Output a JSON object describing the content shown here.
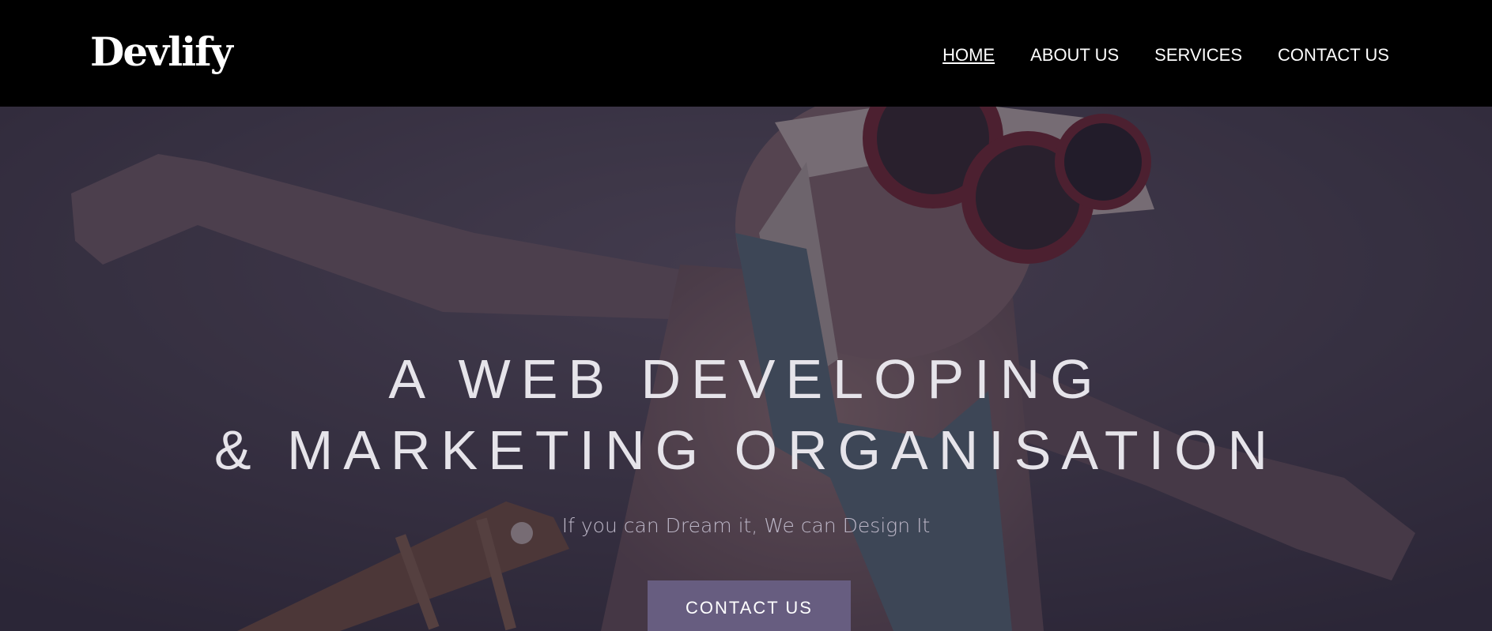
{
  "brand": {
    "logo_text": "Devlify"
  },
  "nav": {
    "items": [
      {
        "label": "HOME",
        "active": true
      },
      {
        "label": "ABOUT US",
        "active": false
      },
      {
        "label": "SERVICES",
        "active": false
      },
      {
        "label": "CONTACT US",
        "active": false
      }
    ]
  },
  "hero": {
    "headline_line1": "A WEB DEVELOPING",
    "headline_line2": "& MARKETING ORGANISATION",
    "tagline": "If you can Dream it, We can Design It",
    "cta_label": "CONTACT US",
    "background_image": "child wearing aviator goggles with arms outstretched"
  },
  "colors": {
    "navbar_bg": "#000000",
    "overlay": "#3a3148",
    "cta_bg": "#675d80",
    "headline": "#e6e4ea"
  }
}
